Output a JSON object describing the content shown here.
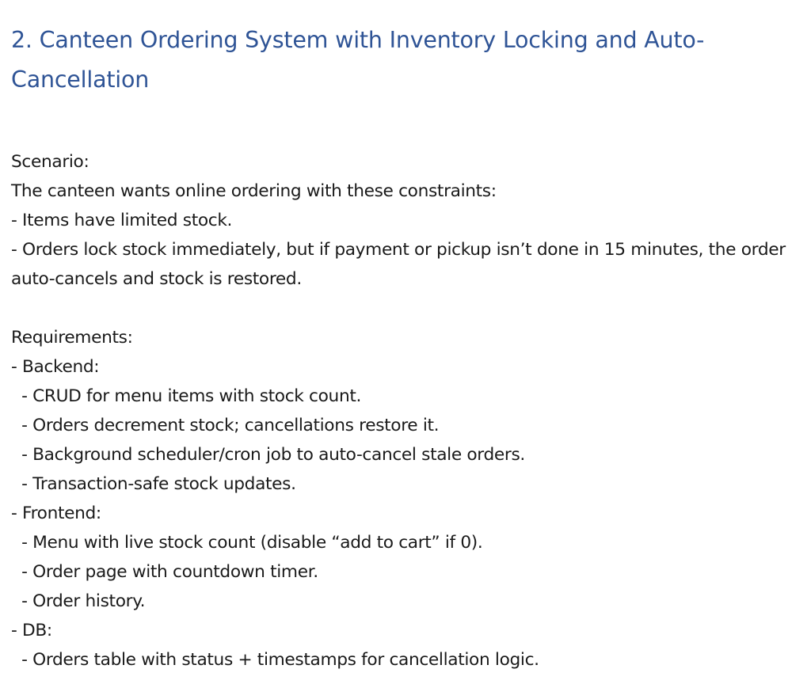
{
  "document": {
    "heading_line1": "2. Canteen Ordering System with Inventory Locking and Auto-",
    "heading_line2": "Cancellation",
    "scenario_label": "Scenario:",
    "scenario_intro": "The canteen wants online ordering with these constraints:",
    "constraint_1": "- Items have limited stock.",
    "constraint_2": "- Orders lock stock immediately, but if payment or pickup isn’t done in 15 minutes, the order auto-cancels and stock is restored.",
    "requirements_label": "Requirements:",
    "backend_label": "- Backend:",
    "backend_items": [
      "  - CRUD for menu items with stock count.",
      "  - Orders decrement stock; cancellations restore it.",
      "  - Background scheduler/cron job to auto-cancel stale orders.",
      "  - Transaction-safe stock updates."
    ],
    "frontend_label": "- Frontend:",
    "frontend_items": [
      "  - Menu with live stock count (disable “add to cart” if 0).",
      "  - Order page with countdown timer.",
      "  - Order history."
    ],
    "db_label": "- DB:",
    "db_items": [
      "  - Orders table with status + timestamps for cancellation logic."
    ]
  }
}
